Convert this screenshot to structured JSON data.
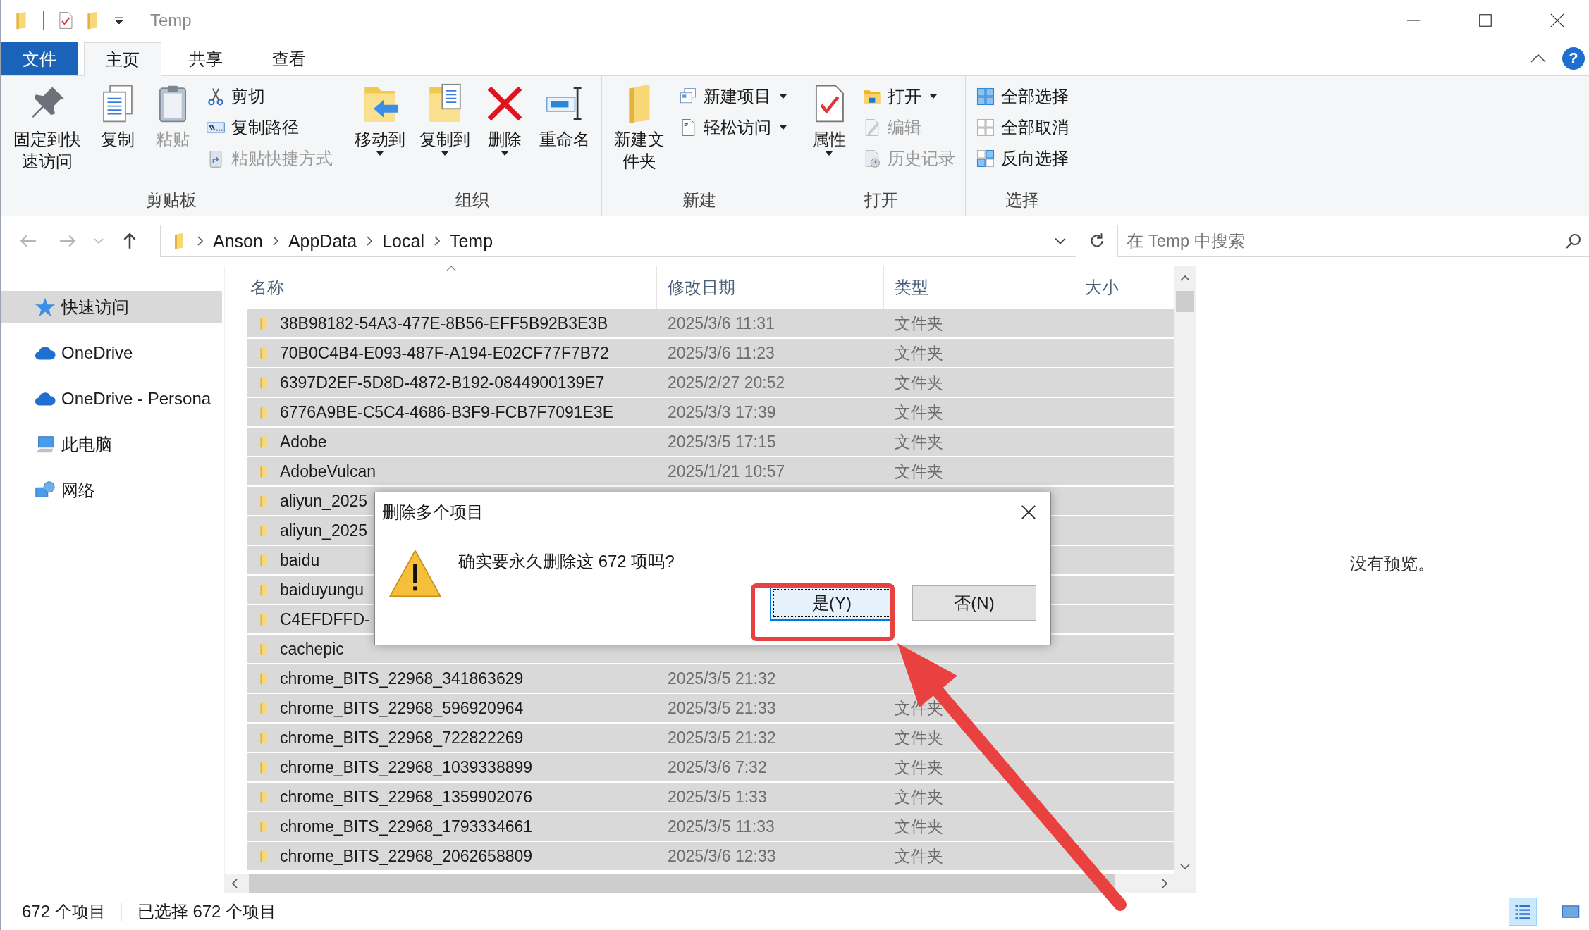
{
  "window": {
    "title": "Temp"
  },
  "tabs": [
    {
      "label": "文件",
      "kind": "file",
      "selected": false
    },
    {
      "label": "主页",
      "kind": "tab",
      "selected": true
    },
    {
      "label": "共享",
      "kind": "tab",
      "selected": false
    },
    {
      "label": "查看",
      "kind": "tab",
      "selected": false
    }
  ],
  "help": {
    "label": "?"
  },
  "ribbon": {
    "groups": [
      {
        "label": "剪贴板",
        "items": [
          {
            "label": "固定到快速访问",
            "kind": "large",
            "disabled": false,
            "dropdown": false
          },
          {
            "label": "复制",
            "kind": "large",
            "disabled": false,
            "dropdown": false
          },
          {
            "label": "粘贴",
            "kind": "large",
            "disabled": true,
            "dropdown": false
          },
          {
            "label": "剪切",
            "kind": "small",
            "disabled": false,
            "dropdown": false
          },
          {
            "label": "复制路径",
            "kind": "small",
            "disabled": false,
            "dropdown": false
          },
          {
            "label": "粘贴快捷方式",
            "kind": "small",
            "disabled": true,
            "dropdown": false
          }
        ]
      },
      {
        "label": "组织",
        "items": [
          {
            "label": "移动到",
            "kind": "large",
            "disabled": false,
            "dropdown": true
          },
          {
            "label": "复制到",
            "kind": "large",
            "disabled": false,
            "dropdown": true
          },
          {
            "label": "删除",
            "kind": "large",
            "disabled": false,
            "dropdown": true
          },
          {
            "label": "重命名",
            "kind": "large",
            "disabled": false,
            "dropdown": false
          }
        ]
      },
      {
        "label": "新建",
        "items": [
          {
            "label": "新建文件夹",
            "kind": "large",
            "disabled": false,
            "dropdown": false
          },
          {
            "label": "新建项目",
            "kind": "small",
            "disabled": false,
            "dropdown": true
          },
          {
            "label": "轻松访问",
            "kind": "small",
            "disabled": false,
            "dropdown": true
          }
        ]
      },
      {
        "label": "打开",
        "items": [
          {
            "label": "属性",
            "kind": "large",
            "disabled": false,
            "dropdown": true
          },
          {
            "label": "打开",
            "kind": "small",
            "disabled": false,
            "dropdown": true
          },
          {
            "label": "编辑",
            "kind": "small",
            "disabled": true,
            "dropdown": false
          },
          {
            "label": "历史记录",
            "kind": "small",
            "disabled": true,
            "dropdown": false
          }
        ]
      },
      {
        "label": "选择",
        "items": [
          {
            "label": "全部选择",
            "kind": "small",
            "disabled": false,
            "dropdown": false
          },
          {
            "label": "全部取消",
            "kind": "small",
            "disabled": false,
            "dropdown": false
          },
          {
            "label": "反向选择",
            "kind": "small",
            "disabled": false,
            "dropdown": false
          }
        ]
      }
    ]
  },
  "address": {
    "path": [
      "Anson",
      "AppData",
      "Local",
      "Temp"
    ],
    "search_placeholder": "在 Temp 中搜索"
  },
  "sidebar": {
    "items": [
      {
        "label": "快速访问",
        "selected": true
      },
      {
        "label": "OneDrive",
        "selected": false
      },
      {
        "label": "OneDrive - Persona",
        "selected": false
      },
      {
        "label": "此电脑",
        "selected": false
      },
      {
        "label": "网络",
        "selected": false
      }
    ]
  },
  "file_list": {
    "columns": [
      "名称",
      "修改日期",
      "类型",
      "大小"
    ],
    "rows": [
      {
        "name": "38B98182-54A3-477E-8B56-EFF5B92B3E3B",
        "date": "2025/3/6 11:31",
        "type": "文件夹",
        "selected": true
      },
      {
        "name": "70B0C4B4-E093-487F-A194-E02CF77F7B72",
        "date": "2025/3/6 11:23",
        "type": "文件夹",
        "selected": true
      },
      {
        "name": "6397D2EF-5D8D-4872-B192-0844900139E7",
        "date": "2025/2/27 20:52",
        "type": "文件夹",
        "selected": true
      },
      {
        "name": "6776A9BE-C5C4-4686-B3F9-FCB7F7091E3E",
        "date": "2025/3/3 17:39",
        "type": "文件夹",
        "selected": true
      },
      {
        "name": "Adobe",
        "date": "2025/3/5 17:15",
        "type": "文件夹",
        "selected": true
      },
      {
        "name": "AdobeVulcan",
        "date": "2025/1/21 10:57",
        "type": "文件夹",
        "selected": true
      },
      {
        "name": "aliyun_2025",
        "selected": true
      },
      {
        "name": "aliyun_2025",
        "selected": true
      },
      {
        "name": "baidu",
        "selected": true
      },
      {
        "name": "baiduyungu",
        "selected": true
      },
      {
        "name": "C4EFDFFD-",
        "selected": true
      },
      {
        "name": "cachepic",
        "selected": true
      },
      {
        "name": "chrome_BITS_22968_341863629",
        "date": "2025/3/5 21:32",
        "selected": true
      },
      {
        "name": "chrome_BITS_22968_596920964",
        "date": "2025/3/5 21:33",
        "type": "文件夹",
        "selected": true
      },
      {
        "name": "chrome_BITS_22968_722822269",
        "date": "2025/3/5 21:32",
        "type": "文件夹",
        "selected": true
      },
      {
        "name": "chrome_BITS_22968_1039338899",
        "date": "2025/3/6 7:32",
        "type": "文件夹",
        "selected": true
      },
      {
        "name": "chrome_BITS_22968_1359902076",
        "date": "2025/3/5 1:33",
        "type": "文件夹",
        "selected": true
      },
      {
        "name": "chrome_BITS_22968_1793334661",
        "date": "2025/3/5 11:33",
        "type": "文件夹",
        "selected": true
      },
      {
        "name": "chrome_BITS_22968_2062658809",
        "date": "2025/3/6 12:33",
        "type": "文件夹",
        "selected": true
      }
    ]
  },
  "preview": {
    "message": "没有预览。"
  },
  "dialog": {
    "title": "删除多个项目",
    "message": "确实要永久删除这 672 项吗?",
    "buttons": [
      {
        "label": "是(Y)",
        "default": true
      },
      {
        "label": "否(N)",
        "default": false
      }
    ]
  },
  "status_bar": {
    "count": "672 个项目",
    "selection": "已选择 672 个项目",
    "views": [
      {
        "selected": true
      },
      {
        "selected": false
      }
    ]
  }
}
